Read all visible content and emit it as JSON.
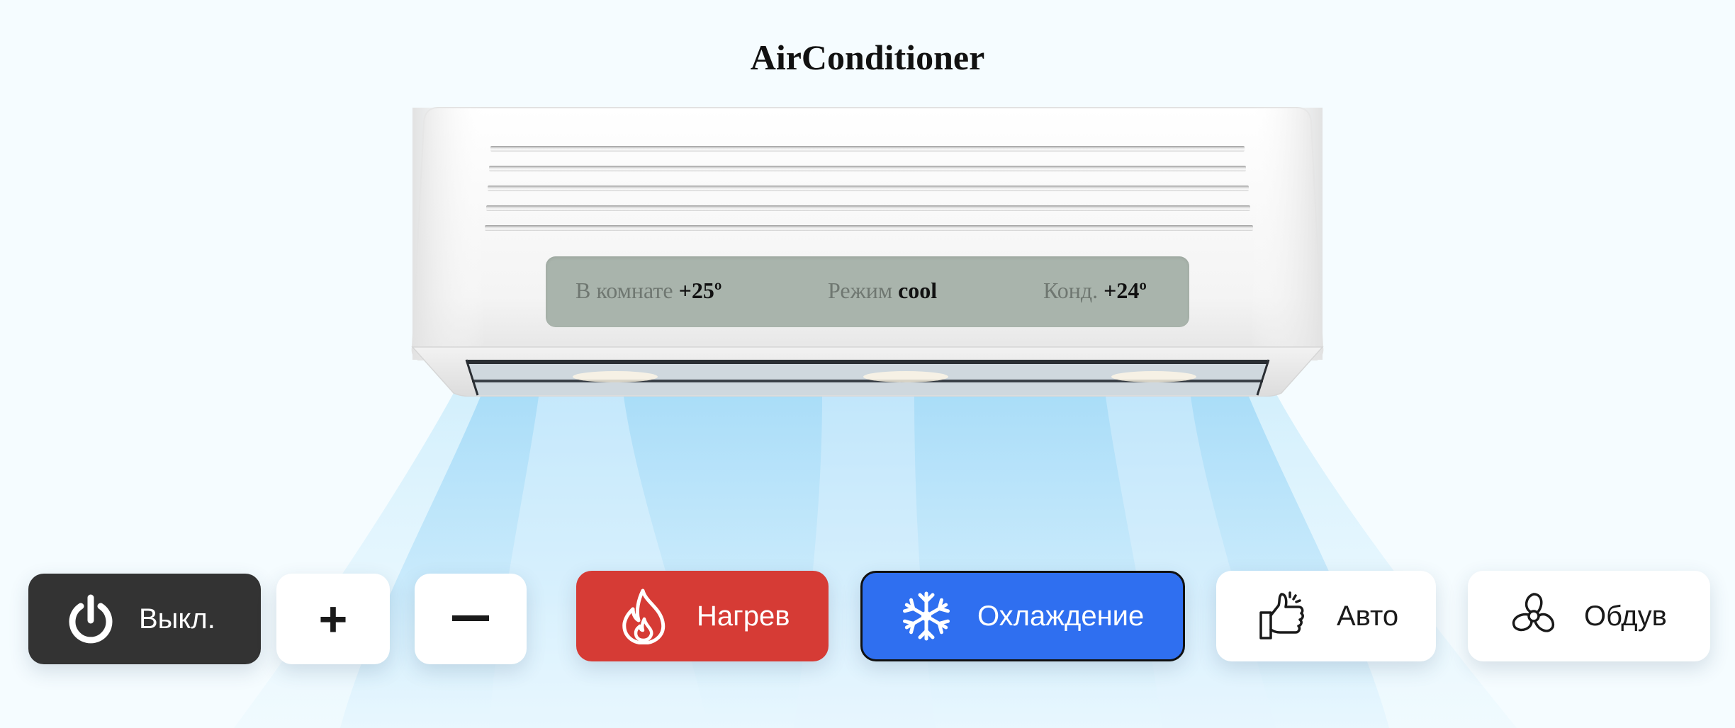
{
  "page": {
    "title": "AirConditioner"
  },
  "display": {
    "room_label": "В комнате",
    "room_value": "+25º",
    "mode_label": "Режим",
    "mode_value": "cool",
    "target_label": "Конд.",
    "target_value": "+24º"
  },
  "controls": {
    "power_label": "Выкл.",
    "plus_label": "+",
    "minus_label": "–",
    "heat_label": "Нагрев",
    "cool_label": "Охлаждение",
    "auto_label": "Авто",
    "fan_label": "Обдув",
    "active_mode": "cool"
  },
  "icons": {
    "power": "power-icon",
    "heat": "flame-icon",
    "cool": "snowflake-icon",
    "auto": "thumbs-up-icon",
    "fan": "fan-icon"
  },
  "colors": {
    "background": "#f5fcff",
    "power_button": "#333333",
    "heat_button": "#d63b35",
    "cool_button": "#2f6ff0",
    "display_panel": "#a9b4ac",
    "airflow": "#a7dcf8"
  }
}
